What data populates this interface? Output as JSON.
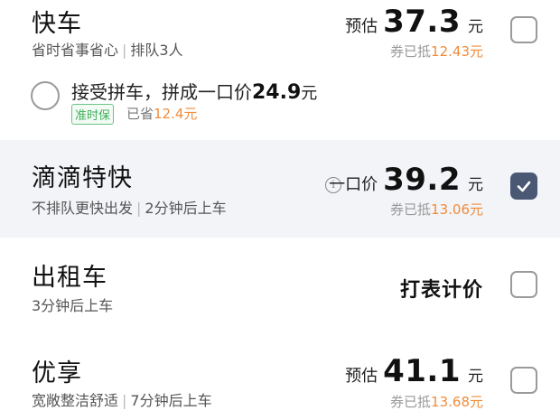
{
  "options": [
    {
      "name": "快车",
      "desc": [
        "省时省事省心",
        "排队3人"
      ],
      "price_prefix": "预估",
      "price": "37.3",
      "unit": "元",
      "discount_prefix": "券已抵",
      "discount": "12.43元",
      "checked": false,
      "carpool": {
        "text": "接受拼车，拼成一口价",
        "price": "24.9",
        "unit": "元",
        "badge": "准时保",
        "saved_prefix": "已省",
        "saved": "12.4元"
      }
    },
    {
      "name": "滴滴特快",
      "desc": [
        "不排队更快出发",
        "2分钟后上车"
      ],
      "info_icon": "i",
      "price_prefix": "一口价",
      "price": "39.2",
      "unit": "元",
      "discount_prefix": "券已抵",
      "discount": "13.06元",
      "checked": true
    },
    {
      "name": "出租车",
      "desc": [
        "3分钟后上车"
      ],
      "meter": "打表计价",
      "checked": false
    },
    {
      "name": "优享",
      "desc": [
        "宽敞整洁舒适",
        "7分钟后上车"
      ],
      "price_prefix": "预估",
      "price": "41.1",
      "unit": "元",
      "discount_prefix": "券已抵",
      "discount": "13.68元",
      "checked": false
    }
  ],
  "colors": {
    "selected_bg": "#f2f4f7",
    "checked_box": "#4a5873",
    "discount_amount": "#f08c3c",
    "badge_green": "#3fae5a"
  }
}
